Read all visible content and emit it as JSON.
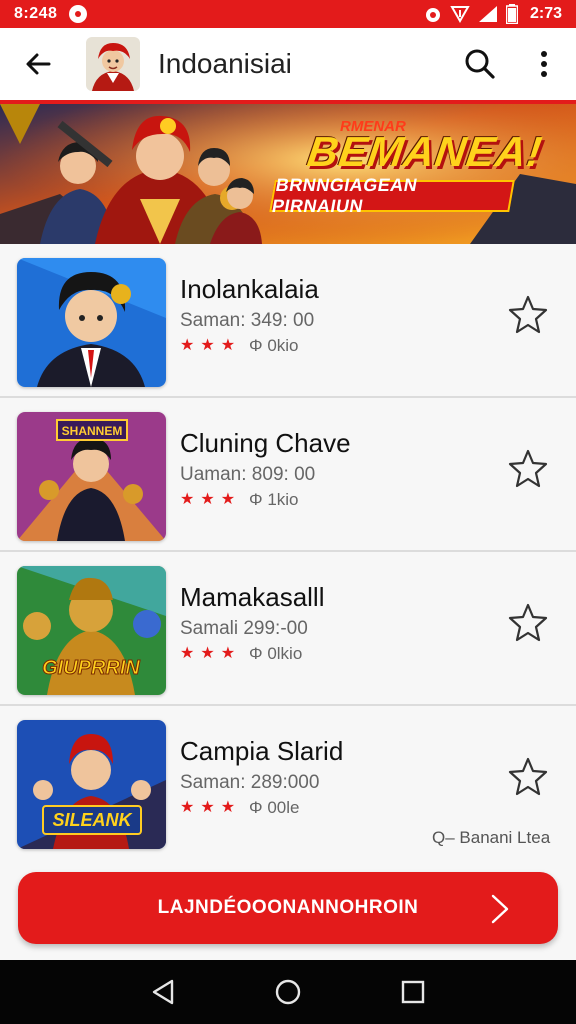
{
  "status_bar": {
    "time_left": "8:248",
    "time_right": "2:73"
  },
  "app_bar": {
    "title": "Indoanisiai",
    "icons": [
      "back-arrow-icon",
      "avatar",
      "search-icon",
      "more-vert-icon"
    ]
  },
  "banner": {
    "kicker": "RMENAR",
    "title": "BEMANEA!",
    "subtitle": "BRNNGIAGEAN PIRNAIUN"
  },
  "items": [
    {
      "name": "Inolankalaia",
      "meta": "Saman: 349: 00",
      "rating_text": "0kio",
      "stars": 3
    },
    {
      "name": "Cluning Chave",
      "meta": "Uaman: 809: 00",
      "rating_text": "1kio",
      "stars": 3
    },
    {
      "name": "Mamakasalll",
      "meta": "Samali 299:-00",
      "rating_text": "0lkio",
      "stars": 3
    },
    {
      "name": "Campia Slarid",
      "meta": "Saman: 289:000",
      "rating_text": "00le",
      "stars": 3
    }
  ],
  "thumb_labels": {
    "item2": "SHANNEM",
    "item3": "GIUPRRIN",
    "item4": "SILEANK"
  },
  "footer_note": "Q– Banani Ltea",
  "cta": {
    "label": "LAJNDÉOOONANNOHROIN"
  },
  "colors": {
    "primary": "#e31b1b",
    "star": "#e31b1b",
    "background": "#f7f7f7"
  }
}
